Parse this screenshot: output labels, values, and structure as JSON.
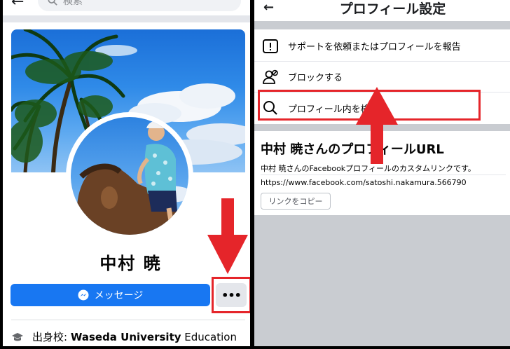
{
  "left": {
    "search_placeholder": "検索",
    "profile_name": "中村 暁",
    "message_button": "メッセージ",
    "more_button": "•••",
    "education": {
      "prefix": "出身校: ",
      "school": "Waseda University",
      "suffix": " Education"
    }
  },
  "right": {
    "header_title": "プロフィール設定",
    "menu": [
      {
        "label": "サポートを依頼またはプロフィールを報告",
        "icon": "report-icon"
      },
      {
        "label": "ブロックする",
        "icon": "block-user-icon"
      },
      {
        "label": "プロフィール内を検",
        "icon": "search-icon"
      }
    ],
    "url_section": {
      "title": "中村 暁さんのプロフィールURL",
      "description": "中村 暁さんのFacebookプロフィールのカスタムリンクです。",
      "url": "https://www.facebook.com/satoshi.nakamura.566790",
      "copy_button": "リンクをコピー"
    }
  },
  "colors": {
    "brand": "#1877f2",
    "highlight": "#e5252a",
    "arrow": "#e5252a"
  }
}
